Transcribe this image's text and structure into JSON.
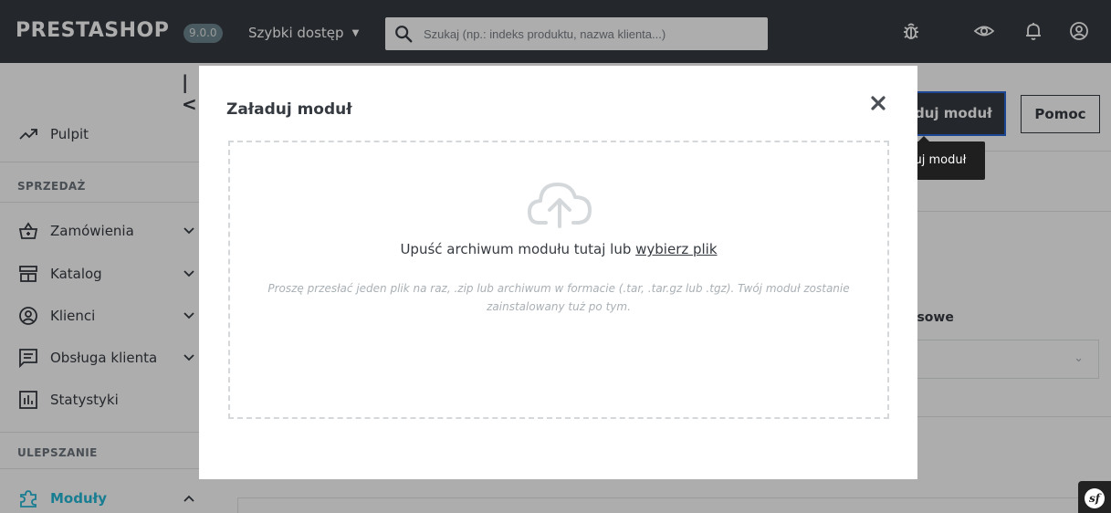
{
  "topbar": {
    "logo": "PRESTASHOP",
    "version": "9.0.0",
    "quick_access": "Szybki dostęp",
    "search_placeholder": "Szukaj (np.: indeks produktu, nazwa klienta...)",
    "icons": [
      "debug-icon",
      "eye-icon",
      "bell-icon",
      "user-icon"
    ]
  },
  "sidebar": {
    "collapse_glyph": "|<",
    "dashboard": "Pulpit",
    "section_sales": "SPRZEDAŻ",
    "items": [
      {
        "label": "Zamówienia",
        "icon": "basket-icon"
      },
      {
        "label": "Katalog",
        "icon": "catalog-icon"
      },
      {
        "label": "Klienci",
        "icon": "customer-icon"
      },
      {
        "label": "Obsługa klienta",
        "icon": "chat-icon"
      },
      {
        "label": "Statystyki",
        "icon": "stats-icon"
      }
    ],
    "section_improve": "ULEPSZANIE",
    "modules": "Moduły"
  },
  "header_buttons": {
    "upload": "Załaduj moduł",
    "upload_visible": "duj moduł",
    "help": "Pomoc"
  },
  "tooltip": "Załaduj moduł",
  "background": {
    "filter_label_partial": "asowe"
  },
  "modal": {
    "title": "Załaduj moduł",
    "drop_text": "Upuść archiwum modułu tutaj lub",
    "choose_file": "wybierz plik",
    "hint": "Proszę przesłać jeden plik na raz, .zip lub archiwum w formacie (.tar, .tar.gz lub .tgz). Twój moduł zostanie zainstalowany tuż po tym."
  },
  "colors": {
    "topbar": "#363a41",
    "accent": "#25b9d7",
    "focus_border": "#2a66d8"
  }
}
